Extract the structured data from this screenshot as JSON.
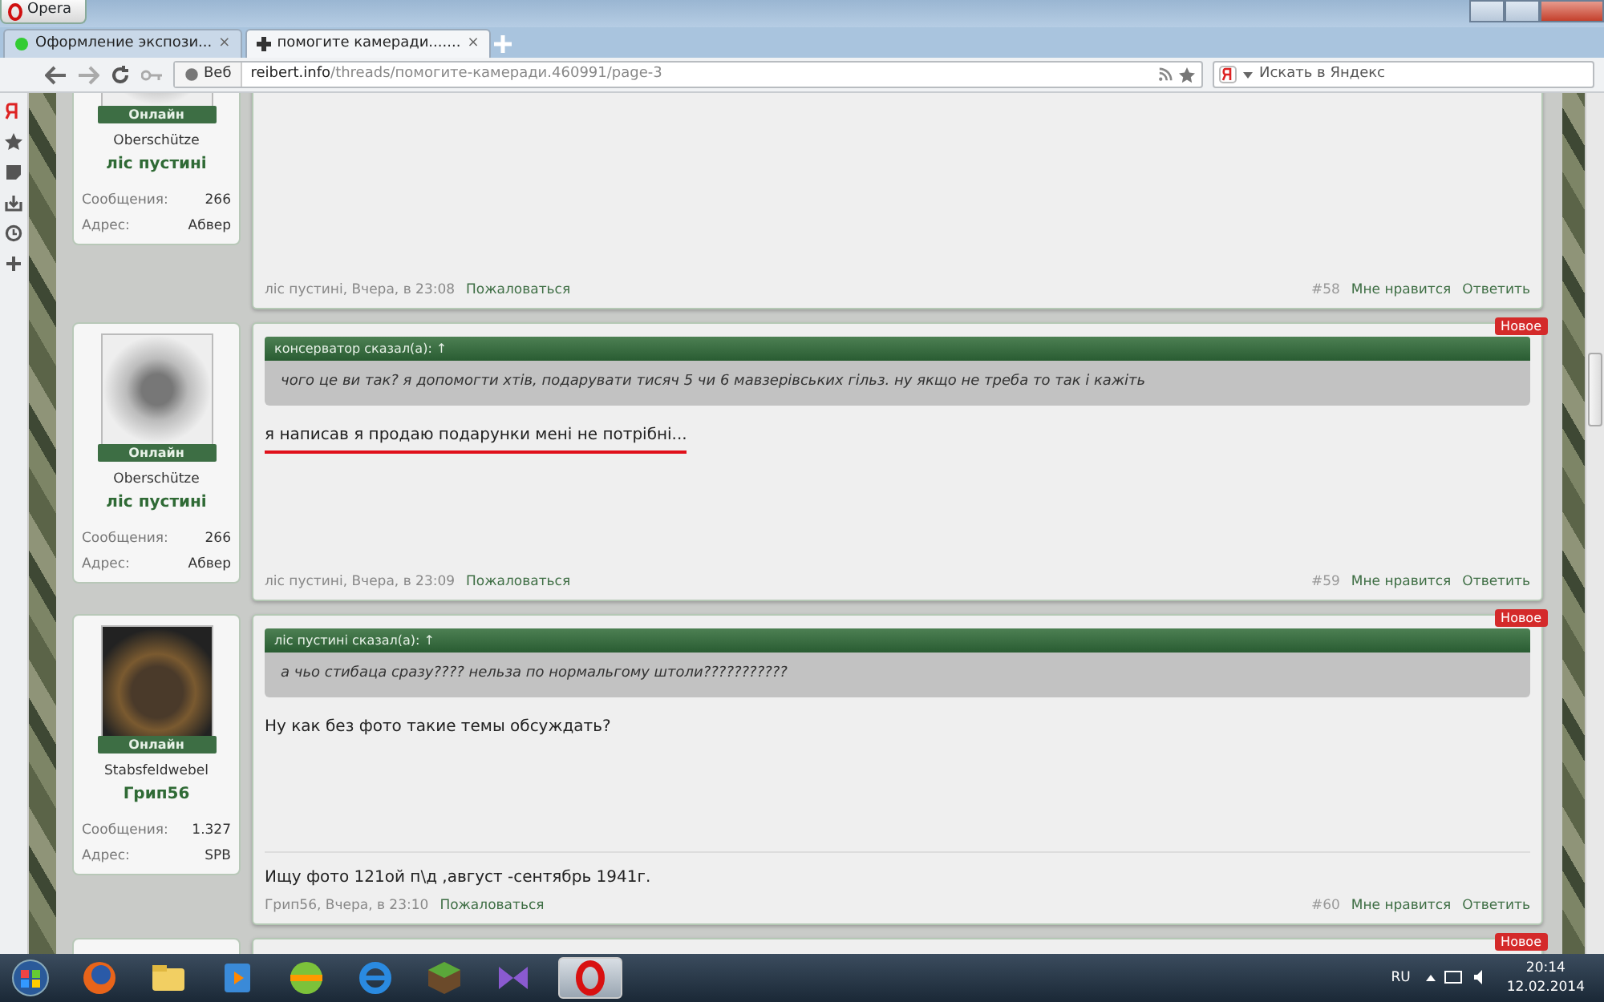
{
  "browser": {
    "menu_button": "Opera",
    "tabs": [
      {
        "title": "Оформление экспози...",
        "selected": false,
        "close": "×"
      },
      {
        "title": "помогите камеради.......",
        "selected": true,
        "close": "×"
      }
    ],
    "address": {
      "label": "Веб",
      "host": "reibert.info",
      "path": "/threads/помогите-камеради.460991/page-3"
    },
    "search": {
      "placeholder": "Искать в Яндекс"
    }
  },
  "posts": [
    {
      "user": {
        "kind": "emblem",
        "status": "Онлайн",
        "rank": "Oberschütze",
        "name": "ліс пустині",
        "stats": [
          {
            "label": "Сообщения:",
            "value": "266"
          },
          {
            "label": "Адрес:",
            "value": "Абвер"
          }
        ]
      },
      "meta": "ліс пустині, Вчера, в 23:08",
      "report": "Пожаловаться",
      "number": "#58",
      "like": "Мне нравится",
      "reply": "Ответить"
    },
    {
      "badge": "Новое",
      "user": {
        "kind": "emblem",
        "status": "Онлайн",
        "rank": "Oberschütze",
        "name": "ліс пустині",
        "stats": [
          {
            "label": "Сообщения:",
            "value": "266"
          },
          {
            "label": "Адрес:",
            "value": "Абвер"
          }
        ]
      },
      "quote": {
        "author": "консерватор сказал(а):",
        "arrow": "↑",
        "text": "чого це ви так? я допомогти хтів, подарувати тисяч 5 чи 6 мавзерівських гільз. ну якщо не треба то так і кажіть"
      },
      "message": {
        "text": "я написав я продаю подарунки мені не потрібні...",
        "underlined": true
      },
      "meta": "ліс пустині, Вчера, в 23:09",
      "report": "Пожаловаться",
      "number": "#59",
      "like": "Мне нравится",
      "reply": "Ответить"
    },
    {
      "badge": "Новое",
      "user": {
        "kind": "photo",
        "status": "Онлайн",
        "rank": "Stabsfeldwebel",
        "name": "Грип56",
        "stats": [
          {
            "label": "Сообщения:",
            "value": "1.327"
          },
          {
            "label": "Адрес:",
            "value": "SPB"
          }
        ]
      },
      "quote": {
        "author": "ліс пустині сказал(а):",
        "arrow": "↑",
        "text": "а чьо стибаца сразу???? нельза по нормальгому штоли???????????"
      },
      "message": {
        "text": "Ну как без фото такие темы обсуждать?",
        "underlined": false
      },
      "signature": "Ищу фото 121ой п\\д ,август -сентябрь 1941г.",
      "meta": "Грип56, Вчера, в 23:10",
      "report": "Пожаловаться",
      "number": "#60",
      "like": "Мне нравится",
      "reply": "Ответить"
    },
    {
      "badge": "Новое"
    }
  ],
  "taskbar": {
    "apps": [
      {
        "kind": "firefox",
        "active": false
      },
      {
        "kind": "folder",
        "active": false
      },
      {
        "kind": "media",
        "active": false
      },
      {
        "kind": "ball",
        "active": false
      },
      {
        "kind": "ie",
        "active": false
      },
      {
        "kind": "cube",
        "active": false
      },
      {
        "kind": "studio",
        "active": false
      },
      {
        "kind": "opera",
        "active": true
      }
    ],
    "language": "RU",
    "time": "20:14",
    "date": "12.02.2014"
  }
}
